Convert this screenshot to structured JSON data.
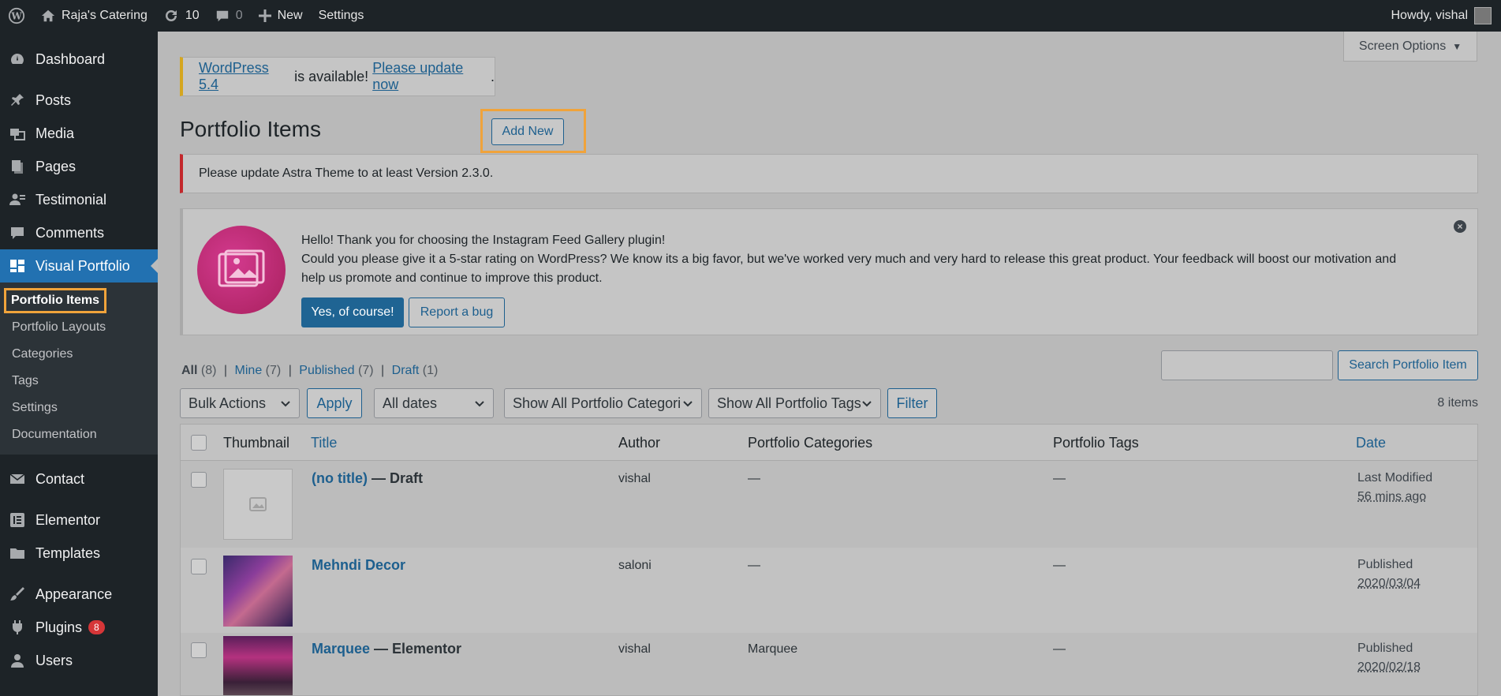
{
  "adminbar": {
    "site_name": "Raja's Catering",
    "updates_count": "10",
    "comments_count": "0",
    "new_label": "New",
    "settings_label": "Settings",
    "howdy": "Howdy, vishal"
  },
  "sidebar": {
    "items": [
      {
        "label": "Dashboard",
        "icon": "dashboard-icon"
      },
      {
        "label": "Posts",
        "icon": "pin-icon"
      },
      {
        "label": "Media",
        "icon": "media-icon"
      },
      {
        "label": "Pages",
        "icon": "pages-icon"
      },
      {
        "label": "Testimonial",
        "icon": "users-icon"
      },
      {
        "label": "Comments",
        "icon": "comments-icon"
      },
      {
        "label": "Visual Portfolio",
        "icon": "portfolio-icon"
      }
    ],
    "submenu": [
      "Portfolio Items",
      "Portfolio Layouts",
      "Categories",
      "Tags",
      "Settings",
      "Documentation"
    ],
    "items_after": [
      {
        "label": "Contact",
        "icon": "mail-icon"
      },
      {
        "label": "Elementor",
        "icon": "elementor-icon"
      },
      {
        "label": "Templates",
        "icon": "folder-icon"
      },
      {
        "label": "Appearance",
        "icon": "brush-icon"
      },
      {
        "label": "Plugins",
        "icon": "plugin-icon",
        "badge": "8"
      },
      {
        "label": "Users",
        "icon": "user-icon"
      }
    ]
  },
  "screen_options": "Screen Options",
  "update_nag": {
    "version_link": "WordPress 5.4",
    "middle": " is available! ",
    "update_link": "Please update now",
    "end": "."
  },
  "page_title": "Portfolio Items",
  "add_new": "Add New",
  "astra_notice": "Please update Astra Theme to at least Version 2.3.0.",
  "insta_notice": {
    "line1": "Hello! Thank you for choosing the Instagram Feed Gallery plugin!",
    "line2": "Could you please give it a 5-star rating on WordPress? We know its a big favor, but we've worked very much and very hard to release this great product. Your feedback will boost our motivation and help us promote and continue to improve this product.",
    "yes_label": "Yes, of course!",
    "bug_label": "Report a bug"
  },
  "views": {
    "all": "All",
    "all_count": "(8)",
    "mine": "Mine",
    "mine_count": "(7)",
    "published": "Published",
    "published_count": "(7)",
    "draft": "Draft",
    "draft_count": "(1)",
    "sep": "|"
  },
  "search": {
    "placeholder": "",
    "button": "Search Portfolio Item"
  },
  "filters": {
    "bulk_actions": "Bulk Actions",
    "apply": "Apply",
    "dates": "All dates",
    "categories": "Show All Portfolio Categori",
    "tags": "Show All Portfolio Tags",
    "filter": "Filter"
  },
  "items_count": "8 items",
  "table": {
    "headers": {
      "thumbnail": "Thumbnail",
      "title": "Title",
      "author": "Author",
      "categories": "Portfolio Categories",
      "tags": "Portfolio Tags",
      "date": "Date"
    },
    "rows": [
      {
        "title": "(no title)",
        "state": " — Draft",
        "author": "vishal",
        "categories": "—",
        "tags": "—",
        "date_status": "Last Modified",
        "date_value": "56 mins ago"
      },
      {
        "title": "Mehndi Decor",
        "state": "",
        "author": "saloni",
        "categories": "—",
        "tags": "—",
        "date_status": "Published",
        "date_value": "2020/03/04"
      },
      {
        "title": "Marquee",
        "state": " — Elementor",
        "author": "vishal",
        "categories": "Marquee",
        "tags": "—",
        "date_status": "Published",
        "date_value": "2020/02/18"
      }
    ]
  },
  "colors": {
    "admin_bar": "#1d2327",
    "menu_current": "#2271b1",
    "highlight_frame": "#f0a33b",
    "link": "#1d5f8e",
    "error_border": "#c3282c"
  }
}
